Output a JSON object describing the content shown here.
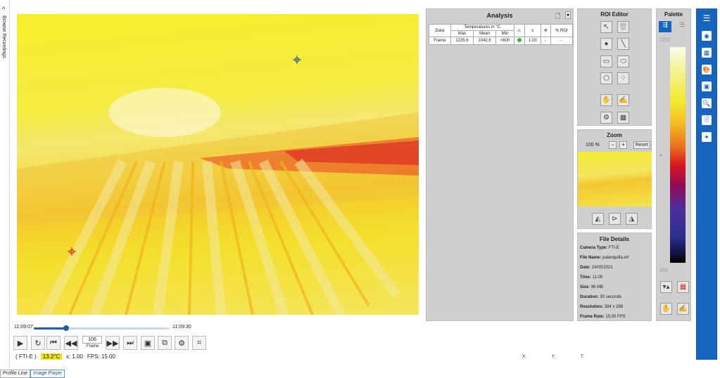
{
  "left_strip": {
    "arrow": "^",
    "label": "Browse Recordings"
  },
  "timeline": {
    "start": "11:09:07",
    "end": "11:09:30",
    "progress": 0.24
  },
  "frame": {
    "value": "106",
    "label": "Frame"
  },
  "status": {
    "source": "( FTI-E )",
    "temp": "13.2°C",
    "epsilon": "ε:  1.00",
    "fps": "FPS:  15.00"
  },
  "coords": {
    "x": "X:",
    "y": "Y:",
    "t": "T:"
  },
  "tabs": [
    "Profile Line",
    "Image Player"
  ],
  "analysis": {
    "title": "Analysis",
    "header_group": "Temperatures in °C",
    "columns": [
      "Data",
      "Max",
      "Mean",
      "Min",
      "ε",
      "% ROI"
    ],
    "row": {
      "data": "Frame",
      "max": "1235.6",
      "mean": "1042.5",
      "min": "<600",
      "eps": "1.00",
      "roi": "-",
      "extra": "-"
    }
  },
  "roi_editor": {
    "title": "ROI Editor"
  },
  "zoom": {
    "title": "Zoom",
    "level": "100 %",
    "reset": "Reset"
  },
  "file_details": {
    "title": "File Details",
    "camera_label": "Camera Type:",
    "camera": "FTI-E",
    "file_label": "File Name:",
    "file": "palanquilla.erf",
    "date_label": "Date:",
    "date": "24/05/2021",
    "time_label": "Time:",
    "time": "11:09",
    "size_label": "Size:",
    "size": "96 MB",
    "duration_label": "Duration:",
    "duration": "30 seconds",
    "res_label": "Resolution:",
    "res": "384 x 288",
    "fr_label": "Frame Rate:",
    "fr": "15.00 FPS"
  },
  "palette": {
    "title": "Palette",
    "max": "1223",
    "min": "309"
  },
  "colors": {
    "accent": "#1565bf",
    "highlight": "#f4e11a"
  }
}
